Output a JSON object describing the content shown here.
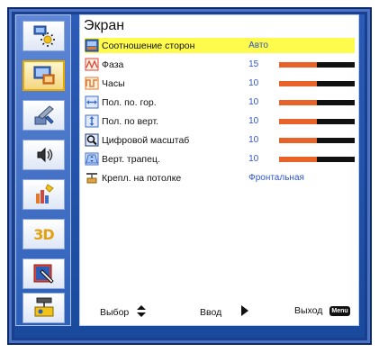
{
  "menu": {
    "title": "Экран",
    "sidebar": [
      {
        "name": "image-settings",
        "icon": "projector-sun-icon"
      },
      {
        "name": "display",
        "icon": "display-icon",
        "active": true
      },
      {
        "name": "setup",
        "icon": "tools-icon"
      },
      {
        "name": "volume",
        "icon": "speaker-icon"
      },
      {
        "name": "options",
        "icon": "options-chart-icon"
      },
      {
        "name": "3d",
        "label": "3D"
      },
      {
        "name": "interactive",
        "icon": "pen-display-icon"
      },
      {
        "name": "lan",
        "icon": "network-projector-icon"
      }
    ],
    "rows": [
      {
        "label": "Соотношение сторон",
        "value": "Авто",
        "icon": "aspect-ratio-icon",
        "selected": true
      },
      {
        "label": "Фаза",
        "value": "15",
        "icon": "phase-icon",
        "bar": 0.5
      },
      {
        "label": "Часы",
        "value": "10",
        "icon": "clock-icon",
        "bar": 0.5
      },
      {
        "label": "Пол. по. гор.",
        "value": "10",
        "icon": "h-position-icon",
        "bar": 0.5
      },
      {
        "label": "Пол. по верт.",
        "value": "10",
        "icon": "v-position-icon",
        "bar": 0.5
      },
      {
        "label": "Цифровой масштаб",
        "value": "10",
        "icon": "zoom-icon",
        "bar": 0.5
      },
      {
        "label": "Верт. трапец.",
        "value": "10",
        "icon": "keystone-icon",
        "bar": 0.5
      },
      {
        "label": "Крепл. на потолке",
        "value": "Фронтальная",
        "icon": "ceiling-mount-icon"
      }
    ],
    "footer": {
      "select_label": "Выбор",
      "enter_label": "Ввод",
      "exit_label": "Выход",
      "menu_key": "Menu"
    }
  },
  "colors": {
    "frame": "#1b3f8e",
    "selected_row": "#fffb4d",
    "bar_fill": "#e8632a",
    "bar_bg": "#111111",
    "value_text": "#2f56c8"
  }
}
